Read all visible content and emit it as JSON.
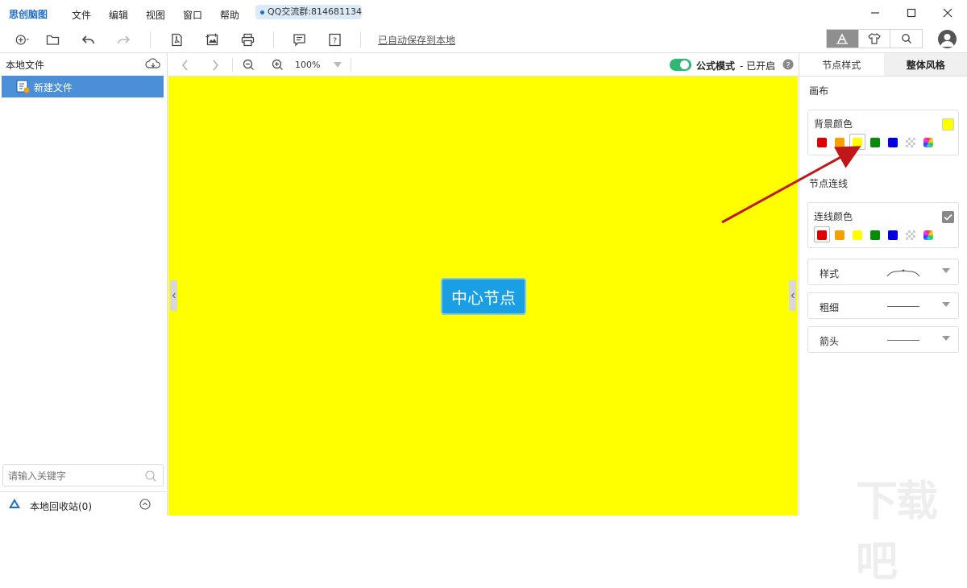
{
  "app": {
    "title": "思创脑图"
  },
  "menu": [
    "文件",
    "编辑",
    "视图",
    "窗口",
    "帮助"
  ],
  "qq_badge": "QQ交流群:814681134",
  "toolbar": {
    "autosave": "已自动保存到本地"
  },
  "sidebar": {
    "header": "本地文件",
    "files": [
      {
        "label": "新建文件"
      }
    ],
    "search_placeholder": "请输入关键字",
    "trash": "本地回收站(0)"
  },
  "canvas_bar": {
    "zoom": "100%",
    "formula_label": "公式模式",
    "formula_state": "- 已开启"
  },
  "canvas": {
    "background": "#ffff00",
    "center_node": "中心节点"
  },
  "right_panel": {
    "tabs": [
      "节点样式",
      "整体风格"
    ],
    "active_tab": 1,
    "canvas_section": "画布",
    "bg_color_label": "背景颜色",
    "link_section": "节点连线",
    "link_color_label": "连线颜色",
    "swatches": [
      "#e00000",
      "#f5a000",
      "#ffff00",
      "#0a8a0a",
      "#0000e0",
      "transparent",
      "rainbow"
    ],
    "bg_selected": 2,
    "link_selected": 0,
    "style_label": "样式",
    "thickness_label": "粗细",
    "arrow_label": "箭头"
  },
  "watermark": "下载吧"
}
